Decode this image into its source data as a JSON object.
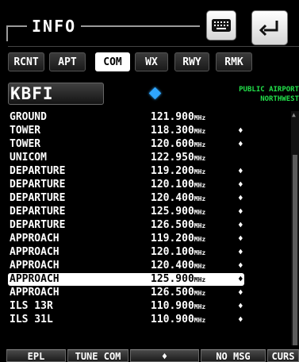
{
  "header": {
    "title": "INFO"
  },
  "tabs": [
    {
      "label": "RCNT"
    },
    {
      "label": "APT"
    },
    {
      "label": "COM",
      "active": true
    },
    {
      "label": "WX"
    },
    {
      "label": "RWY"
    },
    {
      "label": "RMK"
    }
  ],
  "airport": {
    "ident": "KBFI",
    "type_text": "PUBLIC AIRPORT",
    "region_text": "NORTHWEST"
  },
  "frequencies": [
    {
      "name": "GROUND",
      "freq": "121.900",
      "unit": "MHz",
      "marker": ""
    },
    {
      "name": "TOWER",
      "freq": "118.300",
      "unit": "MHz",
      "marker": "♦"
    },
    {
      "name": "TOWER",
      "freq": "120.600",
      "unit": "MHz",
      "marker": "♦"
    },
    {
      "name": "UNICOM",
      "freq": "122.950",
      "unit": "MHz",
      "marker": ""
    },
    {
      "name": "DEPARTURE",
      "freq": "119.200",
      "unit": "MHz",
      "marker": "♦"
    },
    {
      "name": "DEPARTURE",
      "freq": "120.100",
      "unit": "MHz",
      "marker": "♦"
    },
    {
      "name": "DEPARTURE",
      "freq": "120.400",
      "unit": "MHz",
      "marker": "♦"
    },
    {
      "name": "DEPARTURE",
      "freq": "125.900",
      "unit": "MHz",
      "marker": "♦"
    },
    {
      "name": "DEPARTURE",
      "freq": "126.500",
      "unit": "MHz",
      "marker": "♦"
    },
    {
      "name": "APPROACH",
      "freq": "119.200",
      "unit": "MHz",
      "marker": "♦"
    },
    {
      "name": "APPROACH",
      "freq": "120.100",
      "unit": "MHz",
      "marker": "♦"
    },
    {
      "name": "APPROACH",
      "freq": "120.400",
      "unit": "MHz",
      "marker": "♦"
    },
    {
      "name": "APPROACH",
      "freq": "125.900",
      "unit": "MHz",
      "marker": "♦",
      "selected": true
    },
    {
      "name": "APPROACH",
      "freq": "126.500",
      "unit": "MHz",
      "marker": "♦"
    },
    {
      "name": "ILS 13R",
      "freq": "110.900",
      "unit": "MHz",
      "marker": "♦"
    },
    {
      "name": "ILS 31L",
      "freq": "110.900",
      "unit": "MHz",
      "marker": "♦"
    }
  ],
  "softkeys": [
    {
      "label": "EPL"
    },
    {
      "label": "TUNE COM"
    },
    {
      "label": "♦"
    },
    {
      "label": "NO MSG"
    },
    {
      "label": "CURS"
    }
  ],
  "colors": {
    "accent_green": "#22e04a",
    "diamond_blue": "#2fa6ff",
    "selection": "#ffffff"
  },
  "icons": {
    "keyboard": "keyboard-icon",
    "enter": "enter-return-icon",
    "airport_symbol": "diamond-icon"
  }
}
